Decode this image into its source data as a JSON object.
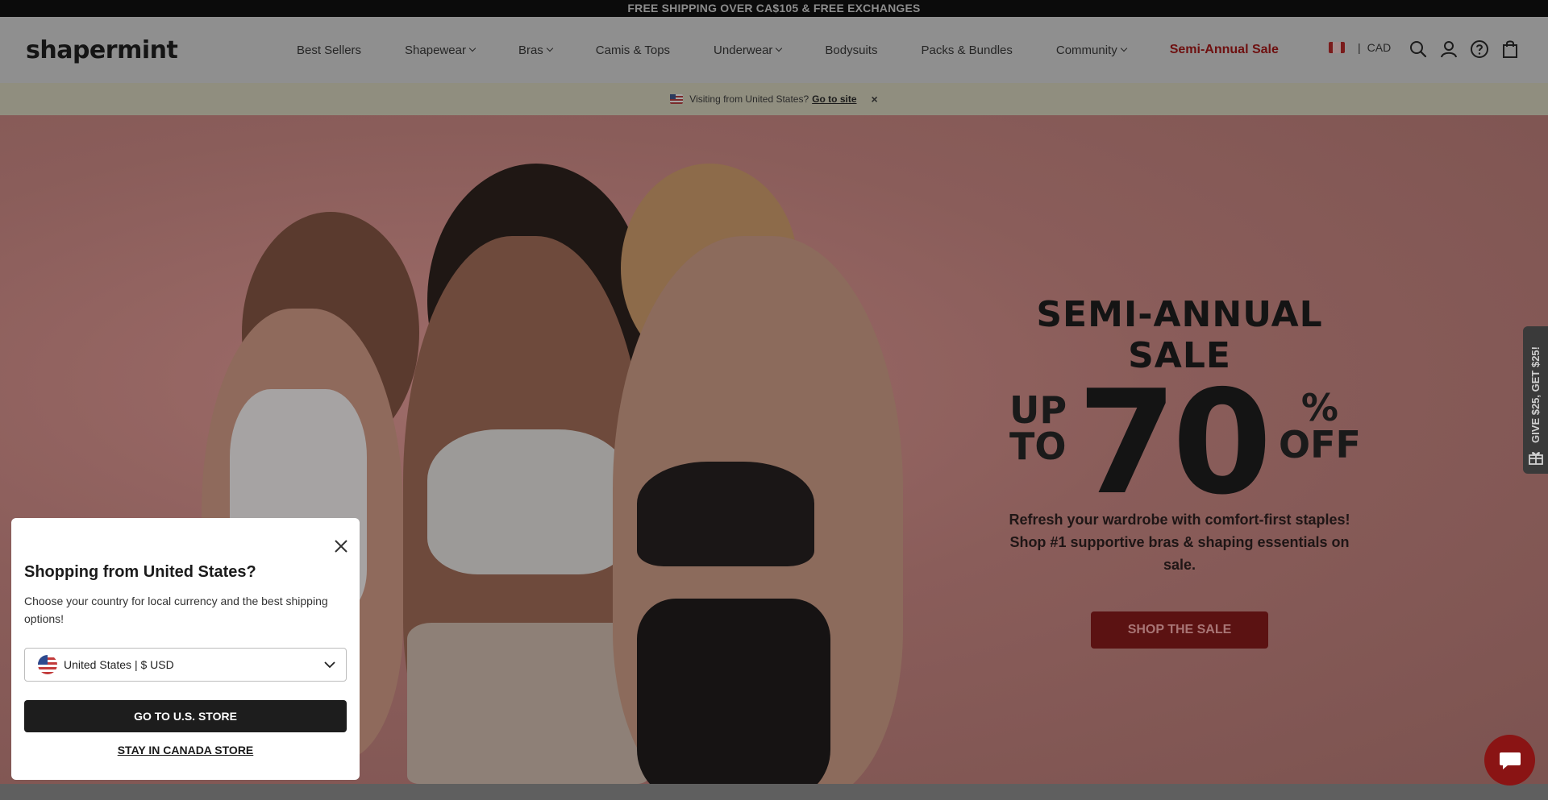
{
  "announcement": "FREE SHIPPING OVER CA$105 & FREE EXCHANGES",
  "header": {
    "logo": "shapermint",
    "nav": [
      {
        "label": "Best Sellers",
        "dropdown": false
      },
      {
        "label": "Shapewear",
        "dropdown": true
      },
      {
        "label": "Bras",
        "dropdown": true
      },
      {
        "label": "Camis & Tops",
        "dropdown": false
      },
      {
        "label": "Underwear",
        "dropdown": true
      },
      {
        "label": "Bodysuits",
        "dropdown": false
      },
      {
        "label": "Packs & Bundles",
        "dropdown": false
      },
      {
        "label": "Community",
        "dropdown": true
      }
    ],
    "sale_link": "Semi-Annual Sale",
    "region": {
      "separator": "|",
      "currency": "CAD"
    },
    "icons": [
      "search-icon",
      "account-icon",
      "help-icon",
      "cart-icon"
    ]
  },
  "visit_banner": {
    "text": "Visiting from United States?",
    "link": "Go to site",
    "close": "×"
  },
  "hero": {
    "title": "SEMI-ANNUAL SALE",
    "up": "UP",
    "to": "TO",
    "number": "70",
    "percent": "%",
    "off": "OFF",
    "sub_line1": "Refresh your wardrobe with comfort-first staples!",
    "sub_line2": "Shop #1 supportive bras & shaping essentials on sale.",
    "cta": "SHOP THE SALE"
  },
  "referral_tab": "GIVE $25, GET $25!",
  "modal": {
    "title": "Shopping from United States?",
    "description": "Choose your country for local currency and the best shipping options!",
    "select_value": "United States | $ USD",
    "primary_button": "GO TO U.S. STORE",
    "secondary_link": "STAY IN CANADA STORE"
  },
  "colors": {
    "accent": "#8a1414",
    "sale_text": "#6e1010",
    "overlay": "rgba(0,0,0,0.45)"
  }
}
